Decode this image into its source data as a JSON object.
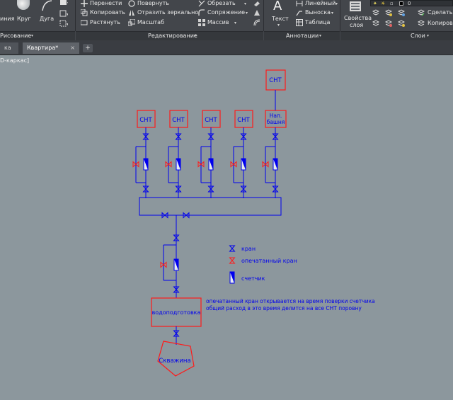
{
  "ribbon": {
    "draw_panel": {
      "polyline_label_partial": "иния",
      "circle_label": "Круг",
      "arc_label": "Дуга",
      "title": "Рисование"
    },
    "modify_panel": {
      "move": "Перенести",
      "rotate": "Повернуть",
      "trim": "Обрезать",
      "copy": "Копировать",
      "mirror": "Отразить зеркально",
      "fillet": "Сопряжение",
      "stretch": "Растянуть",
      "scale": "Масштаб",
      "array": "Массив",
      "title": "Редактирование"
    },
    "annotation_panel": {
      "text": "Текст",
      "linear": "Линейный",
      "leader": "Выноска",
      "table": "Таблица",
      "title": "Аннотации"
    },
    "layers_panel": {
      "layer_properties_line1": "Свойства",
      "layer_properties_line2": "слоя",
      "layer_value": "0",
      "make_current": "Сделать т",
      "copy": "Копиров",
      "title": "Слои"
    }
  },
  "tabs": {
    "first_partial": "ка",
    "active": "Квартира*",
    "close": "×",
    "add": "+"
  },
  "viewport_label": "D-каркас]",
  "diagram": {
    "cnt_label": "СНТ",
    "tower_label_line1": "Нап.",
    "tower_label_line2": "башня",
    "treatment_label": "водоподготовка",
    "well_label": "Скважина",
    "legend": {
      "valve": "кран",
      "sealed_valve": "опечатанный кран",
      "meter": "счетчик"
    },
    "note_line1": "опечатанный кран открывается на время поверки счетчика",
    "note_line2": "общий расход в это время делится на все СНТ поровну"
  },
  "colors": {
    "ribbon_bg": "#43464b",
    "canvas_bg": "#8c979d",
    "diagram_blue": "#0000ee",
    "diagram_red": "#ff1a1a"
  }
}
